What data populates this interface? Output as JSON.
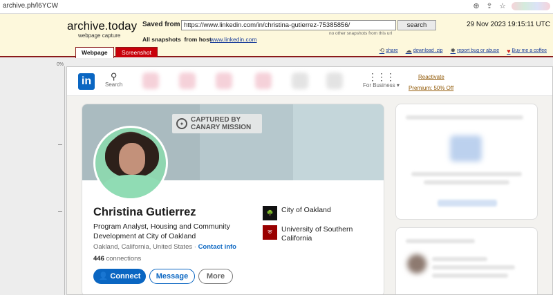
{
  "browser": {
    "url": "archive.ph/l6YCW",
    "icons": [
      "zoom-icon",
      "share-icon",
      "star-icon"
    ]
  },
  "archive": {
    "title": "archive.today",
    "subtitle": "webpage capture",
    "saved_from_label": "Saved from",
    "saved_url": "https://www.linkedin.com/in/christina-gutierrez-75385856/",
    "search_label": "search",
    "no_other": "no other snapshots from this url",
    "all_snapshots_label": "All snapshots",
    "from_host_label": "from host",
    "host_link": "www.linkedin.com",
    "timestamp": "29 Nov 2023 19:15:11 UTC",
    "tabs": {
      "webpage": "Webpage",
      "screenshot": "Screenshot"
    },
    "tools": {
      "share": "share",
      "download": "download .zip",
      "report": "report bug or abuse",
      "coffee": "Buy me a coffee"
    },
    "gutter_percent": "0%"
  },
  "linkedin": {
    "logo_text": "in",
    "search_label": "Search",
    "for_business_label": "For Business",
    "reactivate_label": "Reactivate",
    "premium_label": "Premium: 50% Off",
    "banner_stamp": {
      "line1": "CAPTURED BY",
      "line2": "CANARY MISSION"
    },
    "profile": {
      "name": "Christina Gutierrez",
      "headline": "Program Analyst, Housing and Community Development at City of Oakland",
      "location": "Oakland, California, United States",
      "contact_info_label": "Contact info",
      "connections_count": "446",
      "connections_label": "connections",
      "buttons": {
        "connect": "Connect",
        "message": "Message",
        "more": "More"
      },
      "orgs": [
        {
          "name": "City of Oakland",
          "logo": "oakland-tree-icon"
        },
        {
          "name": "University of Southern California",
          "logo": "usc-shield-icon"
        }
      ]
    }
  }
}
